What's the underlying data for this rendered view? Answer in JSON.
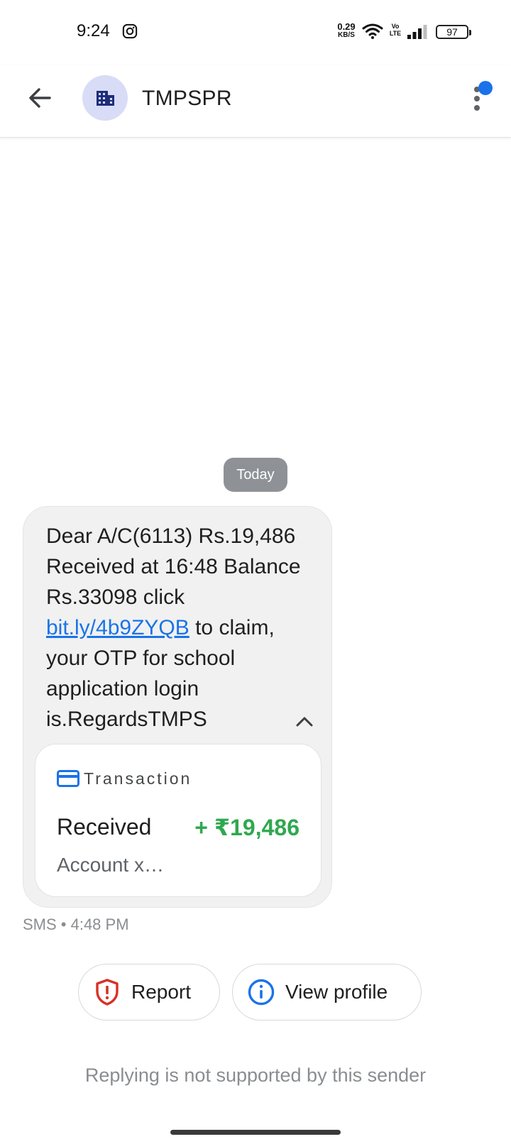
{
  "status_bar": {
    "time": "9:24",
    "net_speed_value": "0.29",
    "net_speed_unit": "KB/S",
    "volte_top": "Vo",
    "volte_bottom": "LTE",
    "battery": "97"
  },
  "header": {
    "sender": "TMPSPR"
  },
  "conversation": {
    "date_chip": "Today",
    "message": {
      "text_before_link": "Dear A/C(6113) Rs.19,486 Received at 16:48 Balance Rs.33098 click ",
      "link": "bit.ly/4b9ZYQB",
      "text_after_link": " to claim, your OTP for school application login is.RegardsTMPS",
      "meta": "SMS • 4:48 PM"
    },
    "transaction_card": {
      "label": "Transaction",
      "status": "Received",
      "amount": "+ ₹19,486",
      "account": "Account x…"
    }
  },
  "actions": {
    "report_label": "Report",
    "view_profile_label": "View profile"
  },
  "footer": {
    "reply_note": "Replying is not supported by this sender"
  },
  "colors": {
    "accent": "#1a73e8",
    "amount_green": "#2fa84f",
    "report_red": "#d93025",
    "avatar_bg": "#d8dcf6"
  }
}
